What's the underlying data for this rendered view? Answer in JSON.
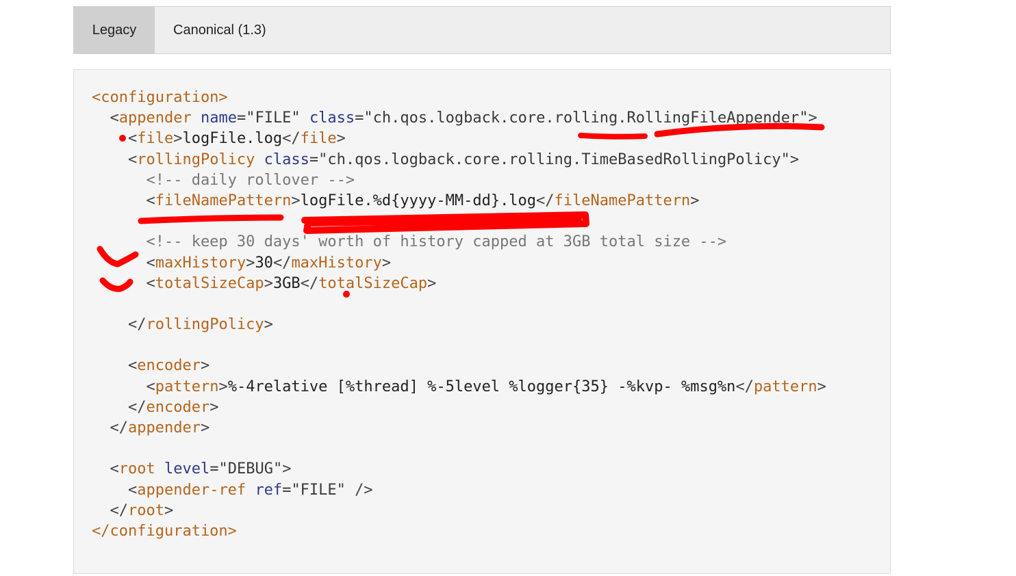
{
  "tabs": [
    {
      "label": "Legacy",
      "active": true
    },
    {
      "label": "Canonical (1.3)",
      "active": false
    }
  ],
  "code": {
    "line1": "<configuration>",
    "line2": {
      "indent": "  ",
      "tag": "appender",
      "attr1": "name",
      "val1": "\"FILE\"",
      "attr2": "class",
      "val2": "\"ch.qos.logback.core.rolling.RollingFileAppender\""
    },
    "line3": {
      "indent": "    ",
      "open": "file",
      "text": "logFile.log",
      "close": "file"
    },
    "line4": {
      "indent": "    ",
      "tag": "rollingPolicy",
      "attr": "class",
      "val": "\"ch.qos.logback.core.rolling.TimeBasedRollingPolicy\""
    },
    "line5": "      <!-- daily rollover -->",
    "line6": {
      "indent": "      ",
      "open": "fileNamePattern",
      "text": "logFile.%d{yyyy-MM-dd}.log",
      "close": "fileNamePattern"
    },
    "line8": "      <!-- keep 30 days' worth of history capped at 3GB total size -->",
    "line9": {
      "indent": "      ",
      "open": "maxHistory",
      "text": "30",
      "close": "maxHistory"
    },
    "line10": {
      "indent": "      ",
      "open": "totalSizeCap",
      "text": "3GB",
      "close": "totalSizeCap"
    },
    "line12": {
      "indent": "    ",
      "close": "rollingPolicy"
    },
    "line14": {
      "indent": "    ",
      "open": "encoder"
    },
    "line15": {
      "indent": "      ",
      "open": "pattern",
      "text": "%-4relative [%thread] %-5level %logger{35} -%kvp- %msg%n",
      "close": "pattern"
    },
    "line16": {
      "indent": "    ",
      "close": "encoder"
    },
    "line17": {
      "indent": "  ",
      "close": "appender"
    },
    "line19": {
      "indent": "  ",
      "tag": "root",
      "attr": "level",
      "val": "\"DEBUG\""
    },
    "line20": {
      "indent": "    ",
      "tag": "appender-ref",
      "attr": "ref",
      "val": "\"FILE\""
    },
    "line21": {
      "indent": "  ",
      "close": "root"
    },
    "line22": "</configuration>"
  },
  "colors": {
    "annotation": "#ff0000",
    "tag": "#b5651d",
    "attribute": "#2f3a8a"
  }
}
